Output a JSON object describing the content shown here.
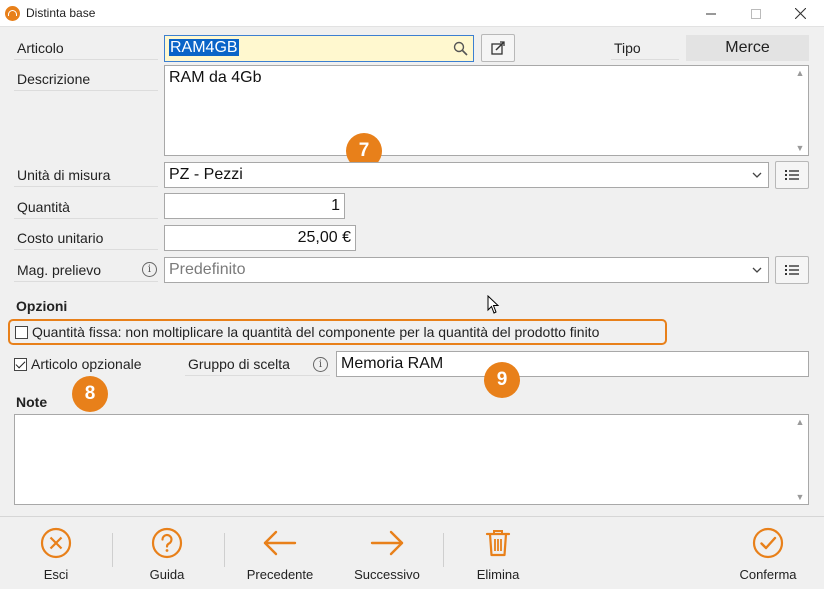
{
  "window": {
    "title": "Distinta base",
    "minimize_icon": "minimize-icon",
    "maximize_icon": "maximize-icon",
    "close_icon": "close-icon"
  },
  "form": {
    "articolo": {
      "label": "Articolo",
      "value": "RAM4GB"
    },
    "tipo": {
      "label": "Tipo",
      "value": "Merce"
    },
    "descrizione": {
      "label": "Descrizione",
      "value": "RAM da 4Gb"
    },
    "unita_misura": {
      "label": "Unità di misura",
      "value": "PZ - Pezzi"
    },
    "quantita": {
      "label": "Quantità",
      "value": "1"
    },
    "costo_unitario": {
      "label": "Costo unitario",
      "value": "25,00 €"
    },
    "mag_prelievo": {
      "label": "Mag. prelievo",
      "value": "Predefinito"
    },
    "opzioni": {
      "title": "Opzioni",
      "quantita_fissa": {
        "label": "Quantità fissa: non moltiplicare la quantità del componente per la quantità del prodotto finito",
        "checked": false
      },
      "articolo_opzionale": {
        "label": "Articolo opzionale",
        "checked": true
      },
      "gruppo_scelta": {
        "label": "Gruppo di scelta",
        "value": "Memoria RAM"
      }
    },
    "note": {
      "label": "Note",
      "value": ""
    }
  },
  "badges": [
    "7",
    "8",
    "9"
  ],
  "toolbar": {
    "esci": "Esci",
    "guida": "Guida",
    "precedente": "Precedente",
    "successivo": "Successivo",
    "elimina": "Elimina",
    "conferma": "Conferma"
  },
  "colors": {
    "accent": "#e8801a",
    "selection": "#0a64c8",
    "focus_bg": "#fff8cf"
  }
}
